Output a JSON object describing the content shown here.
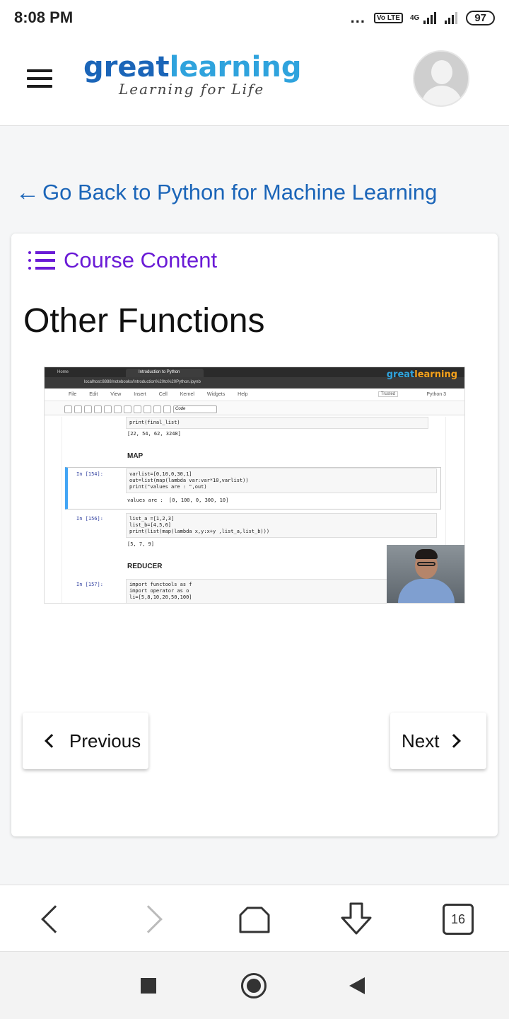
{
  "status_bar": {
    "time": "8:08 PM",
    "dots": "...",
    "volte_label": "Vo LTE",
    "network": "4G",
    "battery": "97"
  },
  "header": {
    "logo_great": "great",
    "logo_learning": "learning",
    "logo_tagline": "Learning for Life"
  },
  "back_link": {
    "arrow": "←",
    "label": "Go Back to Python for Machine Learning"
  },
  "course_content": {
    "label": "Course Content"
  },
  "lesson": {
    "title": "Other Functions"
  },
  "video": {
    "tab_home": "Home",
    "tab_active": "Introduction to Python",
    "address": "localhost:8888/notebooks/Introduction%20to%20Python.ipynb",
    "brand_great": "great",
    "brand_learning": "learning",
    "menu": [
      "File",
      "Edit",
      "View",
      "Insert",
      "Cell",
      "Kernel",
      "Widgets",
      "Help"
    ],
    "trusted": "Trusted",
    "kernel": "Python 3",
    "cell_type": "Code",
    "code_prev": "print(final_list)",
    "out_prev": "[22, 54, 62, 3248]",
    "heading_map": "MAP",
    "prompt_154": "In [154]:",
    "code_154": "varlist=[0,10,0,30,1]\nout=list(map(lambda var:var*10,varlist))\nprint(\"values are : \",out)",
    "out_154": "values are :  [0, 100, 0, 300, 10]",
    "prompt_156": "In [156]:",
    "code_156": "list_a =[1,2,3]\nlist_b=[4,5,6]\nprint(list(map(lambda x,y:x+y ,list_a,list_b)))",
    "out_156": "[5, 7, 9]",
    "heading_reducer": "REDUCER",
    "prompt_157": "In [157]:",
    "code_157": "import functools as f\nimport operator as o\nli=[5,8,10,20,50,100]"
  },
  "navigation": {
    "previous_label": "Previous",
    "next_label": "Next"
  },
  "browser_bar": {
    "tab_count": "16"
  },
  "colors": {
    "link_blue": "#1b65b8",
    "course_purple": "#6a1bd6"
  }
}
